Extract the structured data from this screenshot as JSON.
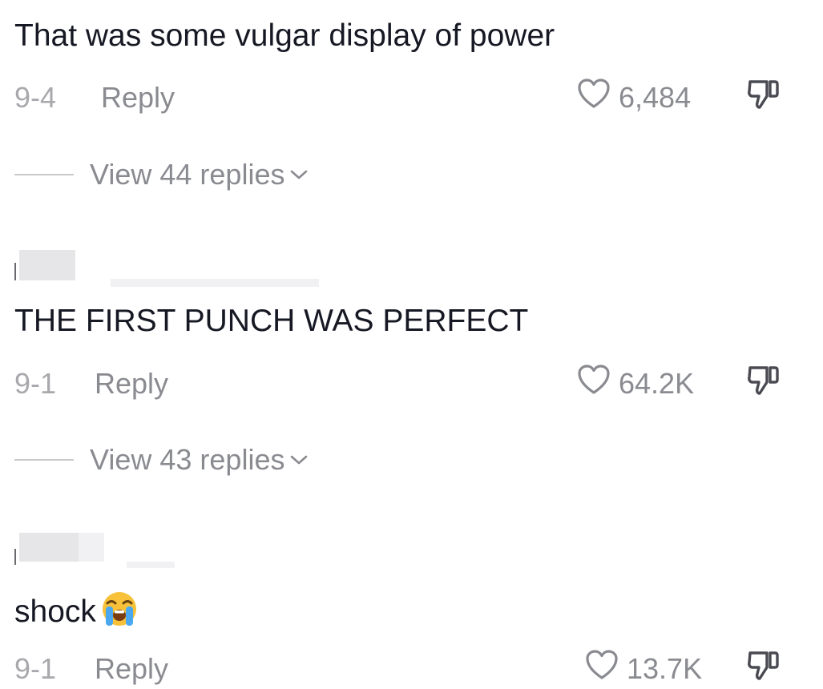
{
  "comments": [
    {
      "text": "That was some vulgar display of power",
      "date": "9-4",
      "reply_label": "Reply",
      "likes": "6,484",
      "view_replies": "View 44 replies"
    },
    {
      "text": "THE FIRST PUNCH WAS PERFECT",
      "date": "9-1",
      "reply_label": "Reply",
      "likes": "64.2K",
      "view_replies": "View 43 replies"
    },
    {
      "text": "shock",
      "emoji": "loudly-crying-face",
      "date": "9-1",
      "reply_label": "Reply",
      "likes": "13.7K"
    }
  ],
  "colors": {
    "text": "#161823",
    "muted": "#8a8b91",
    "date": "#a8a8ad"
  }
}
